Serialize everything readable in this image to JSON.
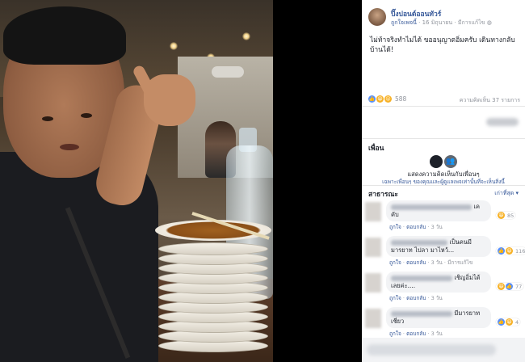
{
  "post": {
    "author": "ปิ๊งปอนด์ออนทัวร์",
    "page_link": "ถูกใจเพจนี้",
    "date": "16 มิถุนายน",
    "meta_extra": "มีการแก้ไข",
    "text": "ไม่ท้าจริงทำไม่ได้ ขออนุญาตอิ่มครับ เดินทางกลับบ้านได้!",
    "reaction_count": "588",
    "comment_count": "ความคิดเห็น 37 รายการ"
  },
  "friends": {
    "title": "เพื่อน",
    "line1": "แสดงความคิดเห็นกับเพื่อนๆ",
    "line2": "เฉพาะเพื่อนๆ ของคุณและผู้ดูแลเพจเท่านั้นที่จะเห็นสิ่งนี้"
  },
  "public": {
    "title": "สาธารณะ",
    "sort": "เก่าที่สุด ▾"
  },
  "comments": [
    {
      "text_a": "เค",
      "text_b": "คับ",
      "like": "ถูกใจ",
      "reply": "ตอบกลับ",
      "time": "3 วัน",
      "edited": "",
      "reacts": "85"
    },
    {
      "text_a": "เป็นคนมี",
      "text_b": "มารยาท ไปลา มาไหว้...",
      "like": "ถูกใจ",
      "reply": "ตอบกลับ",
      "time": "3 วัน",
      "edited": "มีการแก้ไข",
      "reacts": "116"
    },
    {
      "text_a": "เชิญอิ่มได้",
      "text_b": "เลยค่ะ....",
      "like": "ถูกใจ",
      "reply": "ตอบกลับ",
      "time": "3 วัน",
      "edited": "",
      "reacts": "77"
    },
    {
      "text_a": "มีมารยาท",
      "text_b": "เชี่ยว",
      "like": "ถูกใจ",
      "reply": "ตอบกลับ",
      "time": "3 วัน",
      "edited": "",
      "reacts": "4"
    }
  ],
  "icons": {
    "globe": "globe-icon",
    "like": "like-reaction-icon",
    "haha": "haha-reaction-icon",
    "wow": "wow-reaction-icon",
    "friends": "friends-icon"
  },
  "colors": {
    "link": "#365899",
    "like_blue": "#5890ff",
    "muted": "#90949c",
    "bubble": "#f2f3f5"
  }
}
